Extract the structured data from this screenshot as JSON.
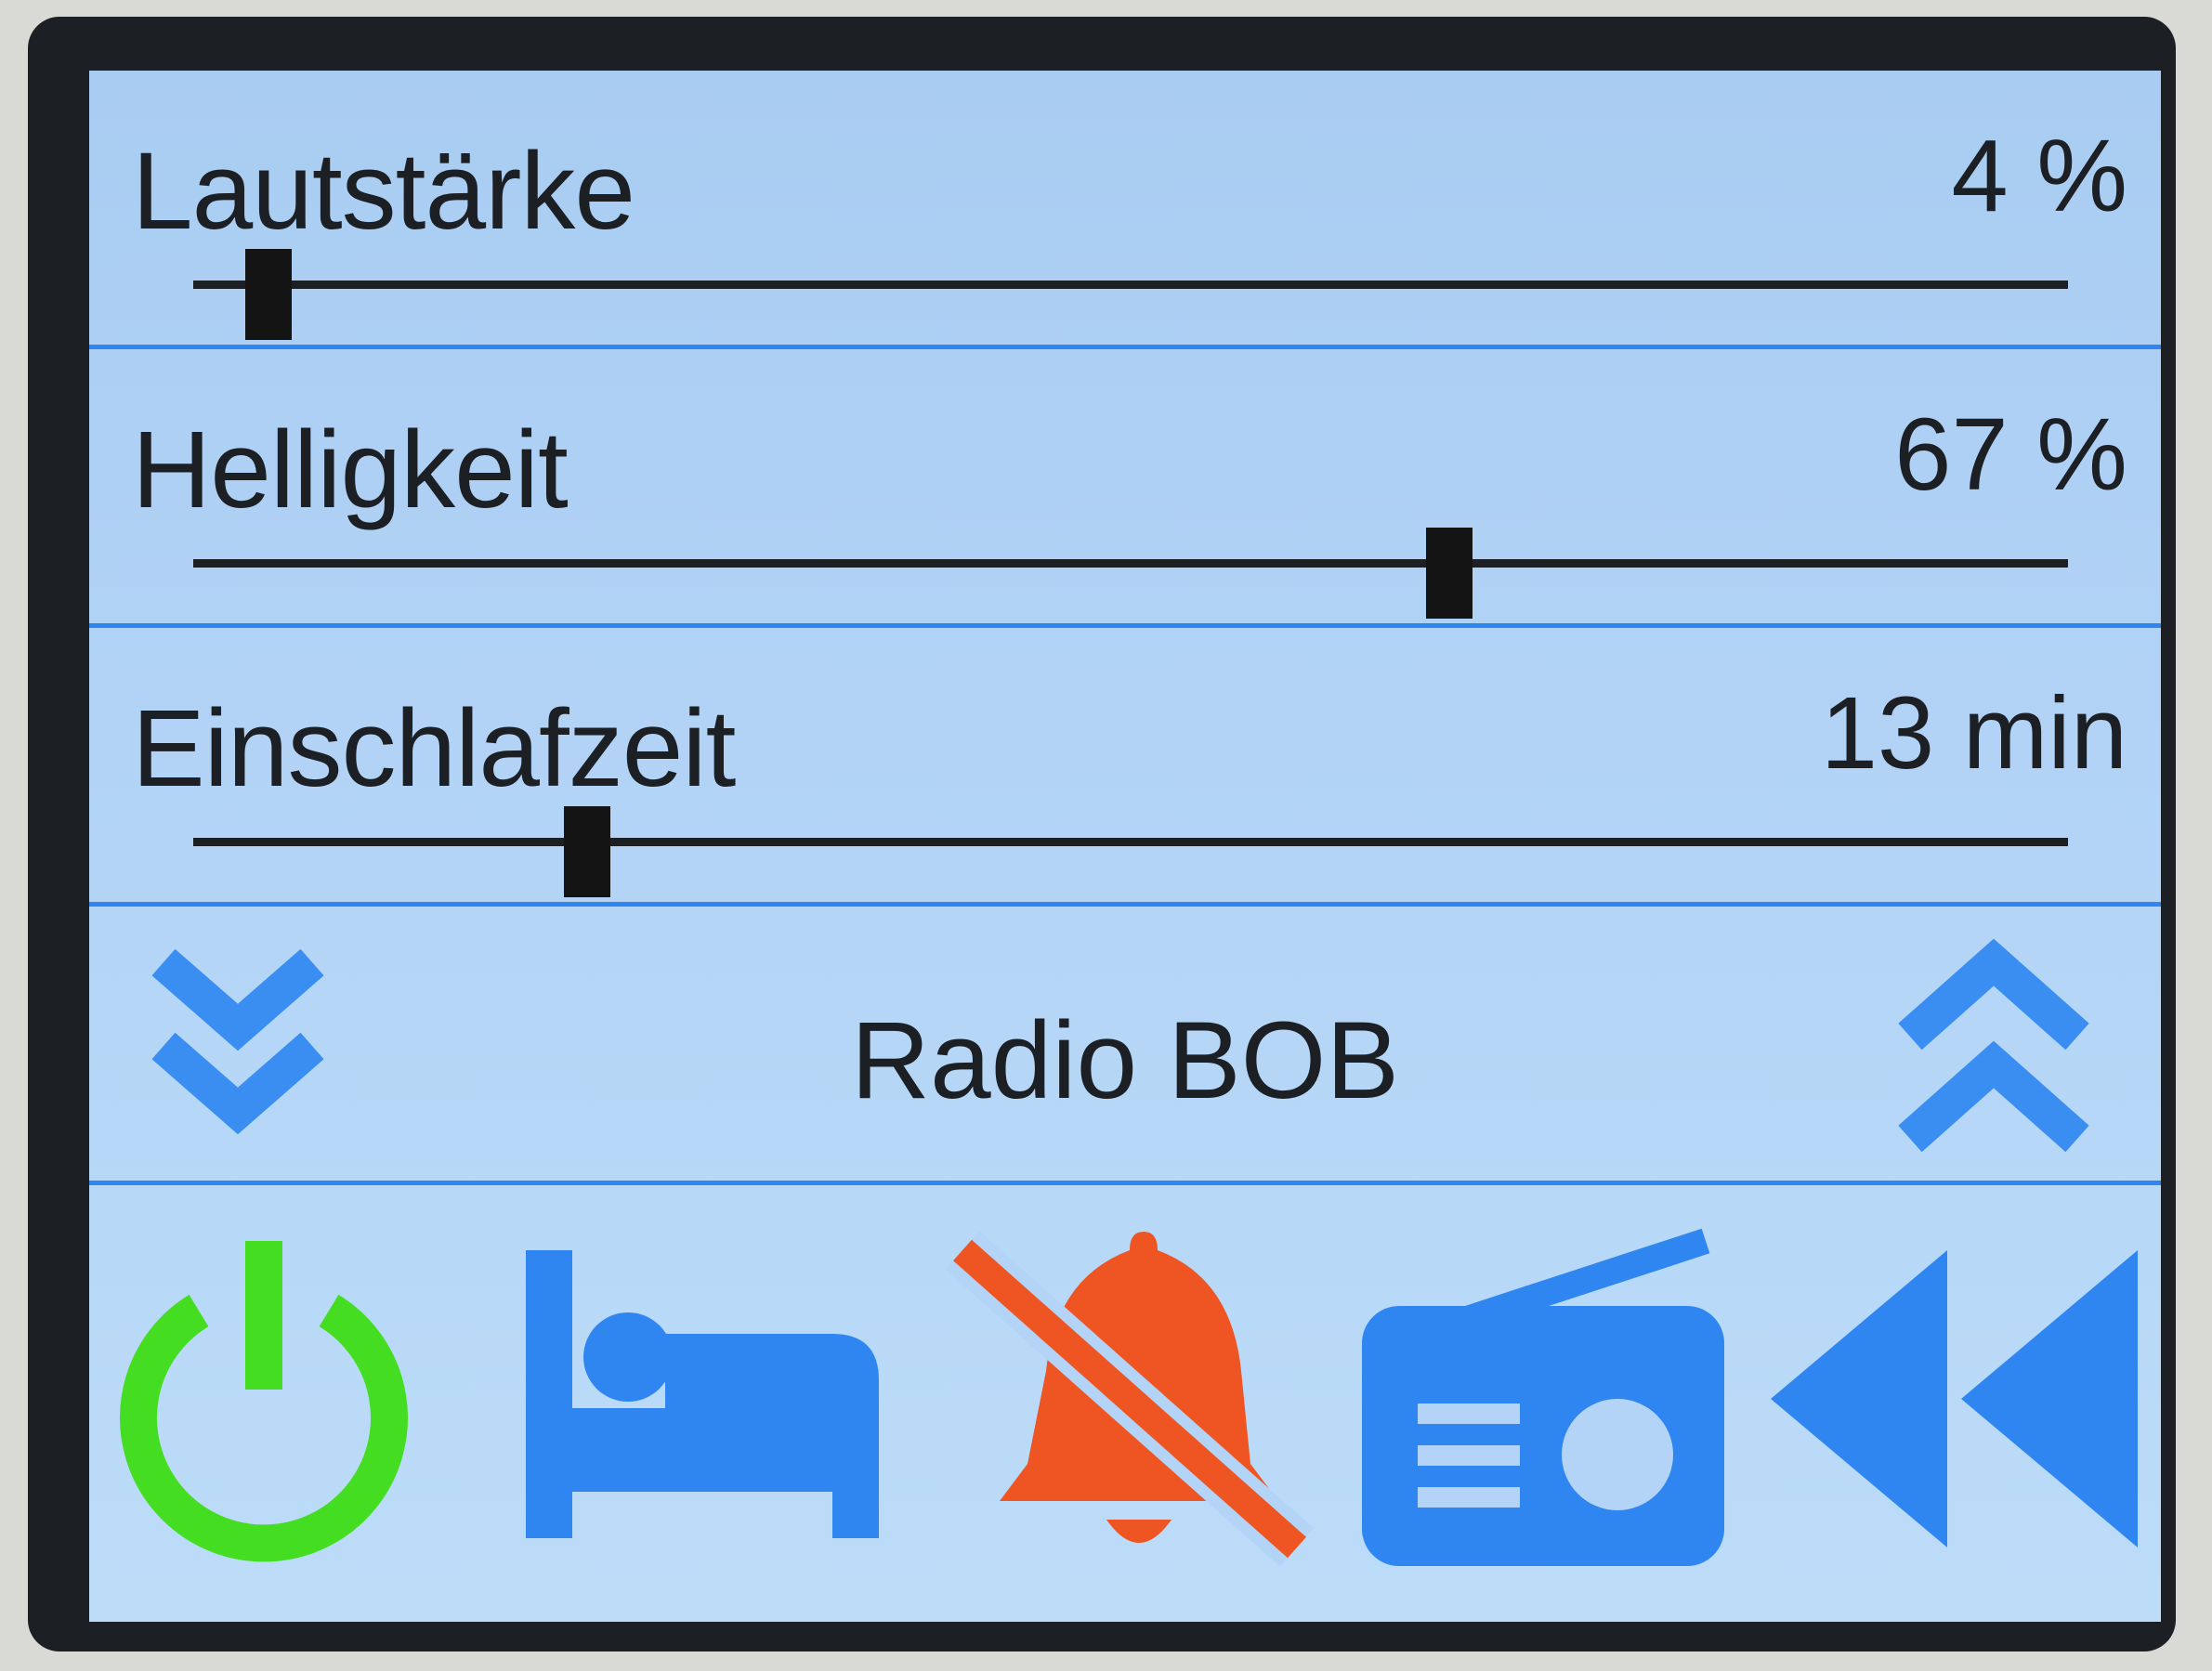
{
  "settings": {
    "volume": {
      "label": "Lautstärke",
      "value": "4 %",
      "level": 0.04
    },
    "brightness": {
      "label": "Helligkeit",
      "value": "67 %",
      "level": 0.67
    },
    "sleep_timer": {
      "label": "Einschlafzeit",
      "value": "13 min",
      "level": 0.21
    }
  },
  "station": {
    "name": "Radio BOB"
  },
  "toolbar": {
    "icons": [
      "power-icon",
      "bed-icon",
      "bell-slash-icon",
      "radio-icon",
      "rewind-icon"
    ]
  },
  "colors": {
    "accent": "#2f86f0",
    "icon_blue": "#2f86f0",
    "power_green": "#44dd22",
    "mute_red": "#ee5522",
    "text": "#1c1f24"
  }
}
